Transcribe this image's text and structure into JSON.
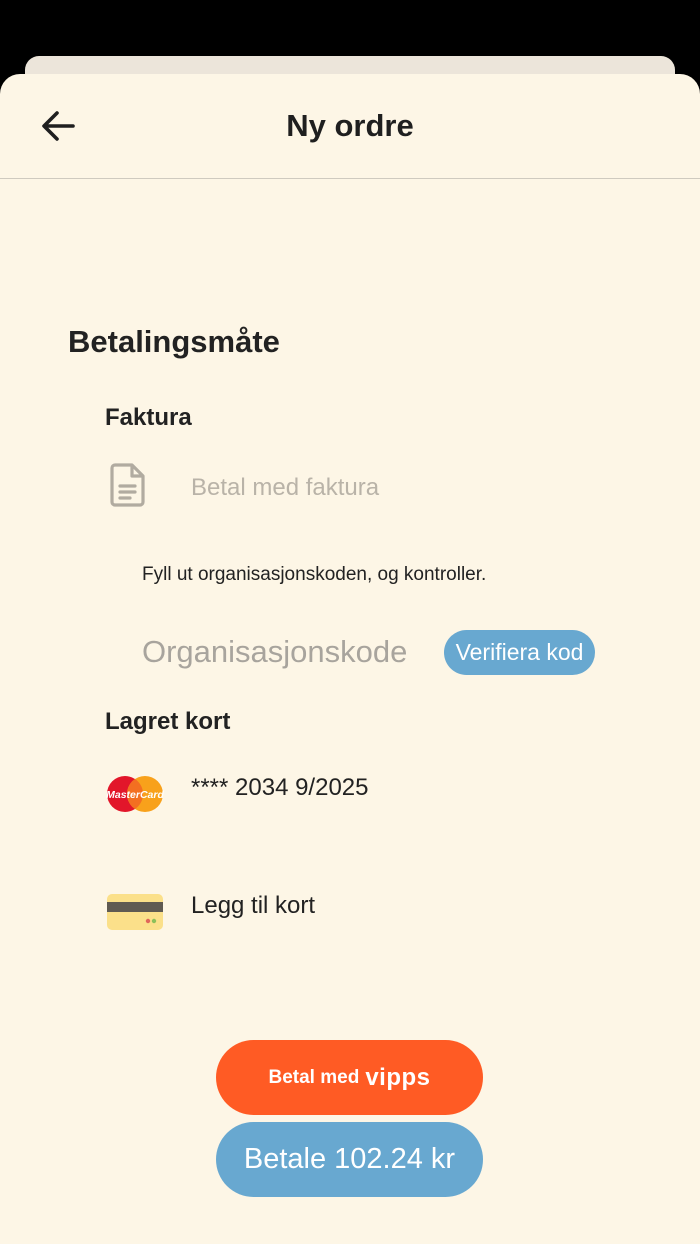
{
  "header": {
    "title": "Ny ordre",
    "back_icon": "arrow-left-icon"
  },
  "payment": {
    "section_title": "Betalingsmåte",
    "invoice": {
      "heading": "Faktura",
      "option_label": "Betal med faktura",
      "icon": "document-icon",
      "hint": "Fyll ut organisasjonskoden, og kontroller.",
      "org_code_placeholder": "Organisasjonskode",
      "org_code_value": "",
      "verify_label": "Verifiera kod"
    },
    "saved_card": {
      "heading": "Lagret kort",
      "card_text": "**** 2034 9/2025",
      "brand_text": "MasterCard",
      "icon": "mastercard-icon"
    },
    "add_card": {
      "label": "Legg til kort",
      "icon": "credit-card-icon"
    }
  },
  "actions": {
    "vipps_label": "Betal med",
    "vipps_brand": "vipps",
    "pay_label": "Betale 102.24 kr"
  },
  "colors": {
    "background": "#fdf6e6",
    "accent_blue": "#68a8d0",
    "vipps_orange": "#ff5b24",
    "text_dark": "#222222",
    "text_muted": "#b9b3a8"
  }
}
